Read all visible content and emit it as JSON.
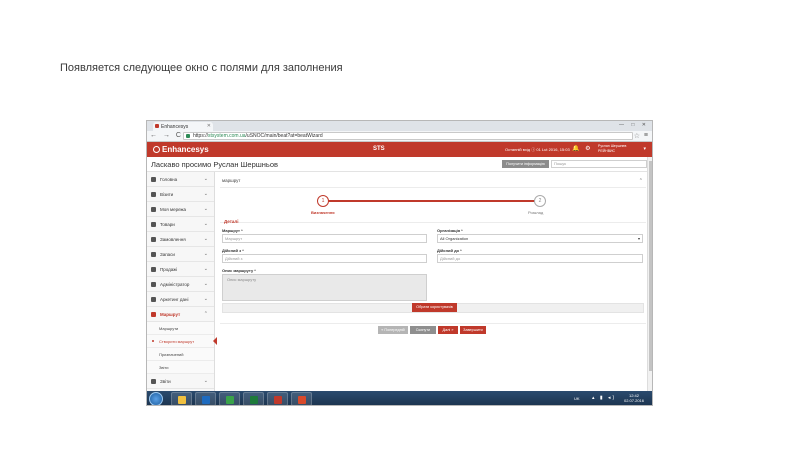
{
  "slide": {
    "caption": "Появляется следующее окно с полями для заполнения"
  },
  "browser": {
    "tab_title": "Enhancesys",
    "url_prefix": "https://",
    "url_host": "stsystem.com.ua",
    "url_path": "/uSNOC/main/beat?at=beatWizard",
    "nav_glyphs": "← → C ⌂",
    "star_glyph": "☆",
    "menu_glyph": "≡",
    "window_controls": "— □ ✕"
  },
  "header": {
    "logo": "Enhancesys",
    "title": "STS",
    "info_text": "Останній вхід ⓘ 01 Lut 2016, 15:03",
    "icons_glyphs": "🔔 ⚙",
    "user_line1": "Руслан Шершнев",
    "user_line2": "РЕЙНВИС"
  },
  "greeting": {
    "text": "Ласкаво просимо Руслан Шершньов",
    "info_button": "Получити інформацію",
    "search_placeholder": "Пошук"
  },
  "sidebar": {
    "items": [
      {
        "label": "Головна"
      },
      {
        "label": "Візити"
      },
      {
        "label": "Моя мережа"
      },
      {
        "label": "Товари"
      },
      {
        "label": "Замовлення"
      },
      {
        "label": "Запаси"
      },
      {
        "label": "Продажі"
      },
      {
        "label": "Адміністратор"
      },
      {
        "label": "Аркетинг дані"
      },
      {
        "label": "Маршрут"
      }
    ],
    "sub_items": [
      {
        "label": "Маршрути"
      },
      {
        "label": "Створити маршрут"
      },
      {
        "label": "Призначений"
      },
      {
        "label": "Звіти"
      }
    ],
    "last_item": {
      "label": "Звіти"
    }
  },
  "content": {
    "panel_title": "маршрут",
    "steps": [
      {
        "num": "1",
        "label": "Визначення"
      },
      {
        "num": "2",
        "label": "Розклад"
      }
    ],
    "fieldset_label": "Деталі",
    "fields": {
      "route_label": "Маршрут *",
      "route_placeholder": "Маршрут",
      "org_label": "Організація *",
      "org_value": "All Organization",
      "from_label": "Дійсний з *",
      "from_placeholder": "Дійсний з",
      "to_label": "Дійсний до *",
      "to_placeholder": "Дійсний до",
      "desc_label": "Опис маршруту *",
      "desc_placeholder": "Опис маршруту"
    },
    "select_arrow": "▾",
    "select_customers_button": "Обрати користувачів",
    "nav_buttons": {
      "prev": "« Попередній",
      "reset": "Скинути",
      "next": "Далі »",
      "finish": "Завершити"
    }
  },
  "taskbar": {
    "lang": "UK",
    "tray_glyphs": "▴ ▮ ◂)",
    "time": "12:42",
    "date": "02.07.2016",
    "app_colors": [
      "#f0c040",
      "#1e6bbf",
      "#3aa34a",
      "#1d7a3a",
      "#c0392b",
      "#d94a2b"
    ]
  },
  "colors": {
    "accent": "#c0392b",
    "taskbar": "#1b324d"
  }
}
